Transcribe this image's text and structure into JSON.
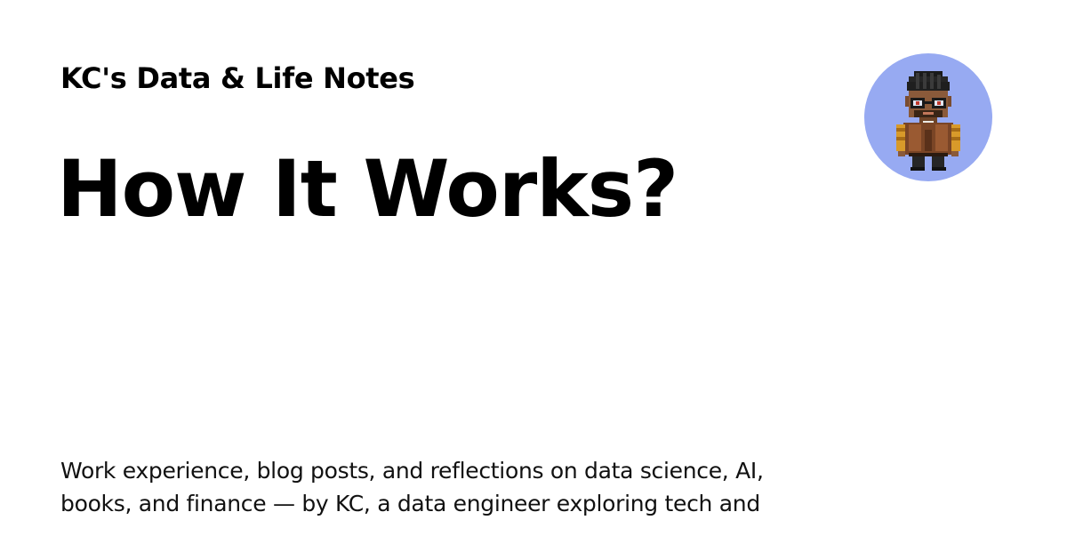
{
  "site": {
    "title": "KC's Data & Life Notes"
  },
  "page": {
    "title": "How It Works?",
    "description": "Work experience, blog posts, and reflections on data science, AI, books, and finance — by KC, a data engineer exploring tech and"
  },
  "avatar": {
    "icon": "pixel-art-person-avatar",
    "background_color": "#97aaf2"
  }
}
